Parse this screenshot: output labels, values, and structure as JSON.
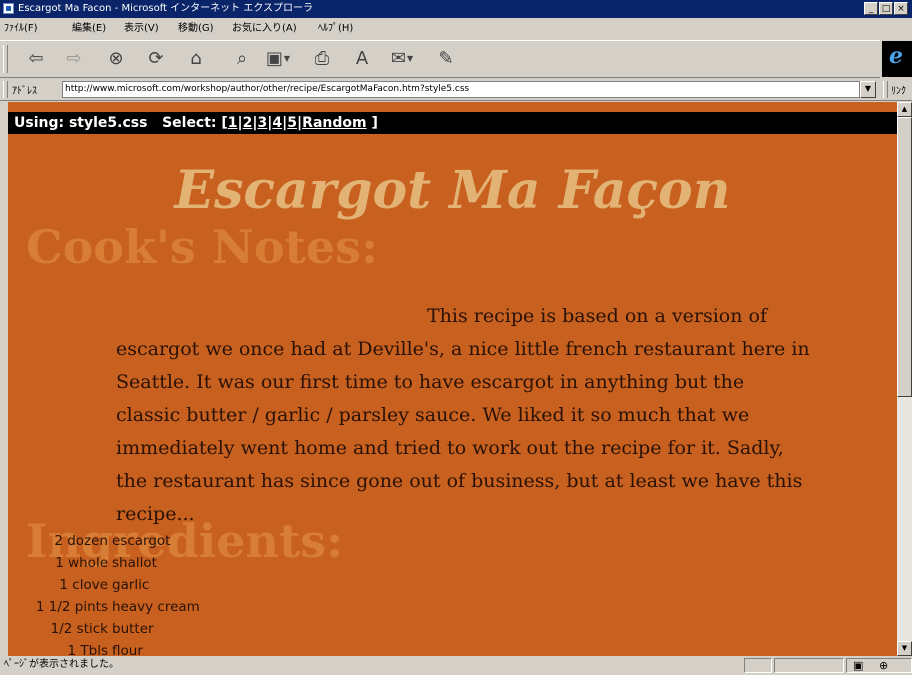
{
  "window": {
    "title": "Escargot Ma Facon - Microsoft インターネット エクスプローラ",
    "minimize": "_",
    "maximize": "□",
    "close": "×"
  },
  "menu": [
    "ﾌｧｲﾙ(F)",
    "編集(E)",
    "表示(V)",
    "移動(G)",
    "お気に入り(A)",
    "ﾍﾙﾌﾟ(H)"
  ],
  "toolbar": {
    "buttons": [
      {
        "name": "back-icon",
        "glyph": "⇦"
      },
      {
        "name": "forward-icon",
        "glyph": "⇨"
      },
      {
        "name": "stop-icon",
        "glyph": "⊗"
      },
      {
        "name": "refresh-icon",
        "glyph": "⟳"
      },
      {
        "name": "home-icon",
        "glyph": "⌂"
      },
      {
        "name": "search-icon",
        "glyph": "⌕"
      },
      {
        "name": "favorites-icon",
        "glyph": "▣"
      },
      {
        "name": "print-icon",
        "glyph": "⎙"
      },
      {
        "name": "font-icon",
        "glyph": "A"
      },
      {
        "name": "mail-icon",
        "glyph": "✉"
      },
      {
        "name": "edit-icon",
        "glyph": "✎"
      }
    ],
    "brand": "e"
  },
  "address": {
    "label": "ｱﾄﾞﾚｽ",
    "url": "http://www.microsoft.com/workshop/author/other/recipe/EscargotMaFacon.htm?style5.css",
    "links_label": "ﾘﾝｸ"
  },
  "page": {
    "style_bar": {
      "using": "Using: style5.css",
      "select": "Select: [",
      "options": [
        "1",
        "2",
        "3",
        "4",
        "5"
      ],
      "random": "Random",
      "close_bracket": "]"
    },
    "title": "Escargot Ma Façon",
    "notes_heading": "Cook's Notes:",
    "notes_text": "This recipe is based on a version of escargot we once had at Deville's, a nice little french restaurant here in Seattle. It was our first time to have escargot in anything but the classic butter / garlic / parsley sauce. We liked it so much that we immediately went home and tried to work out the recipe for it. Sadly, the restaurant has since gone out of business, but at least we have this recipe...",
    "ingredients_heading": "Ingredients:",
    "ingredients": [
      {
        "qty": "2 dozen",
        "item": "escargot"
      },
      {
        "qty": "1 whole",
        "item": "shallot"
      },
      {
        "qty": "1 clove",
        "item": "garlic"
      },
      {
        "qty": "1 1/2 pints",
        "item": "heavy cream"
      },
      {
        "qty": "1/2 stick",
        "item": "butter"
      },
      {
        "qty": "1 Tbls",
        "item": "flour"
      }
    ]
  },
  "status": {
    "text": "ﾍﾟｰｼﾞが表示されました。"
  },
  "colors": {
    "page_bg": "#c8601f",
    "title": "#e2b374",
    "watermark_heading": "#d87d36",
    "body_text": "#2a1206",
    "titlebar": "#0a246a"
  }
}
